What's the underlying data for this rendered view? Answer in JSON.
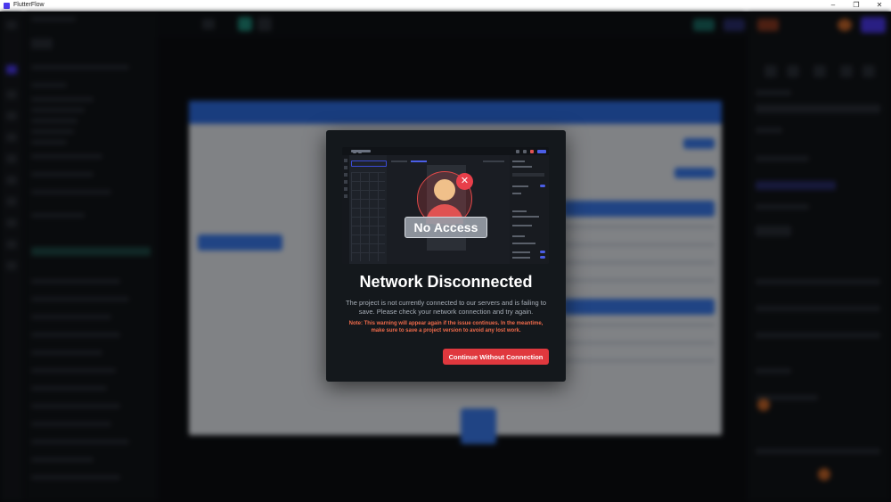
{
  "window": {
    "title": "FlutterFlow",
    "minimize_glyph": "–",
    "restore_glyph": "❐",
    "close_glyph": "✕"
  },
  "dialog": {
    "illustration_label": "No Access",
    "close_badge_glyph": "✕",
    "title": "Network Disconnected",
    "body": "The project is not currently connected to our servers and is failing to save. Please check your network connection and try again.",
    "note": "Note: This warning will appear again if the issue continues. In the meantime, make sure to save a project version to avoid any lost work.",
    "continue_label": "Continue Without Connection"
  },
  "colors": {
    "accent_red": "#e0383e",
    "brand_purple": "#4b39ef",
    "note_orange": "#ef6a4a"
  },
  "icons": {
    "app": "flutterflow-logo-icon",
    "badge": "close-icon",
    "avatar": "user-avatar-icon"
  }
}
